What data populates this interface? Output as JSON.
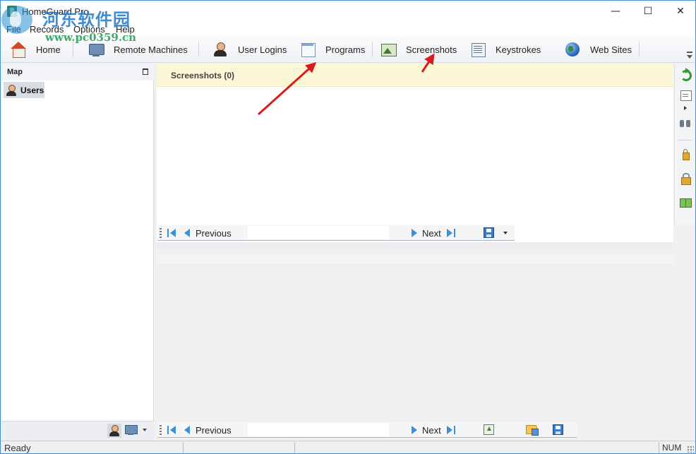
{
  "window": {
    "title": "HomeGuard Pro",
    "controls": {
      "minimize": "—",
      "maximize": "☐",
      "close": "✕"
    }
  },
  "watermark": {
    "title": "河东软件园",
    "url": "www.pc0359.cn"
  },
  "menu": {
    "items": [
      "File",
      "Records",
      "Options",
      "Help"
    ]
  },
  "toolbar": {
    "items": [
      {
        "label": "Home",
        "icon": "home-icon"
      },
      {
        "label": "Remote Machines",
        "icon": "remote-machines-icon"
      },
      {
        "label": "User Logins",
        "icon": "user-logins-icon"
      },
      {
        "label": "Programs",
        "icon": "programs-icon"
      },
      {
        "label": "Screenshots",
        "icon": "screenshots-icon"
      },
      {
        "label": "Keystrokes",
        "icon": "keystrokes-icon"
      },
      {
        "label": "Web Sites",
        "icon": "web-sites-icon"
      }
    ]
  },
  "left_pane": {
    "title": "Map",
    "tree": [
      {
        "label": "Users",
        "icon": "user-icon",
        "selected": true
      }
    ]
  },
  "main": {
    "section_title": "Screenshots (0)"
  },
  "navigation": {
    "previous_label": "Previous",
    "next_label": "Next"
  },
  "status_bar": {
    "text": "Ready",
    "num": "NUM"
  },
  "colors": {
    "accent": "#3d8fd6",
    "section_header_bg": "#fcf7d6",
    "annotation_arrow": "#d91c1c",
    "window_border": "#3c8fd8"
  }
}
